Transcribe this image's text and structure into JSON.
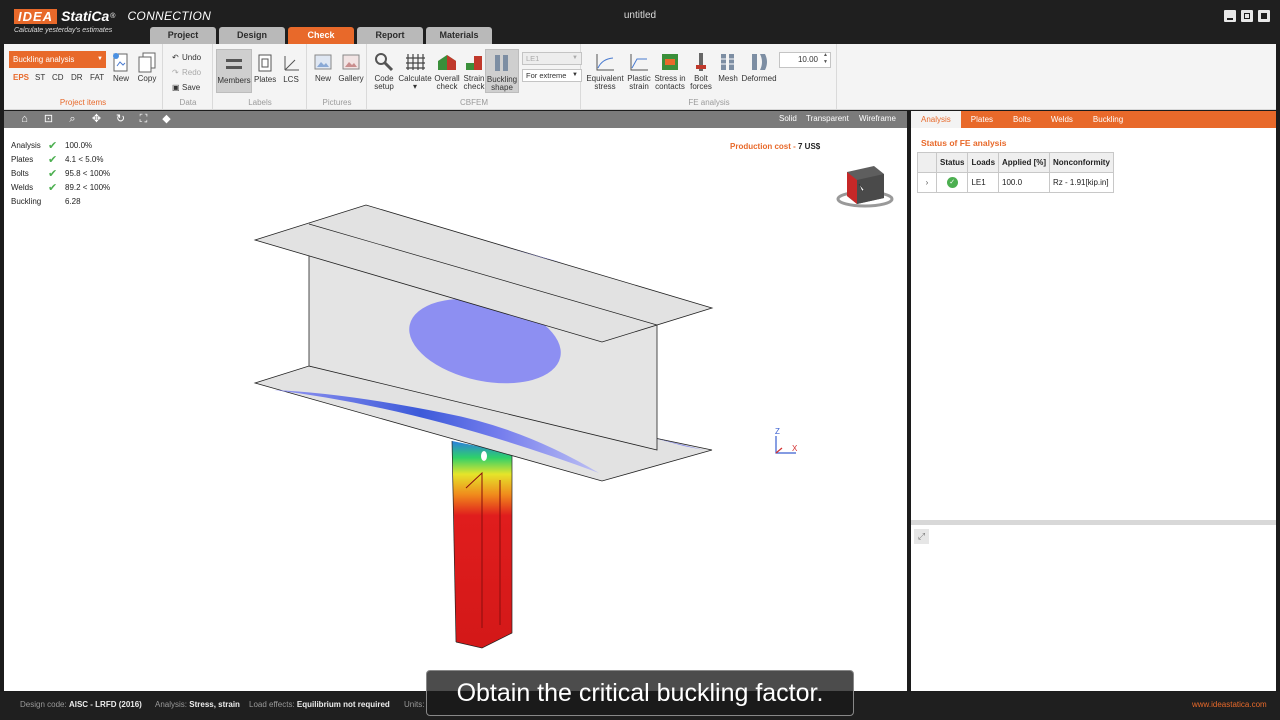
{
  "app": {
    "logo_idea": "IDEA",
    "logo_statica": "StatiCa",
    "logo_reg": "®",
    "product": "CONNECTION",
    "slogan": "Calculate yesterday's estimates",
    "document_title": "untitled"
  },
  "tabs": [
    {
      "label": "Project",
      "active": false
    },
    {
      "label": "Design",
      "active": false
    },
    {
      "label": "Check",
      "active": true
    },
    {
      "label": "Report",
      "active": false
    },
    {
      "label": "Materials",
      "active": false
    }
  ],
  "ribbon": {
    "project_items": {
      "check_type": "Buckling analysis",
      "check_tabs": [
        "EPS",
        "ST",
        "CD",
        "DR",
        "FAT"
      ],
      "active_check_tab": "EPS",
      "new_label": "New",
      "copy_label": "Copy",
      "group_label": "Project items"
    },
    "data": {
      "undo": "Undo",
      "redo": "Redo",
      "save": "Save",
      "group_label": "Data"
    },
    "labels": {
      "members": "Members",
      "plates": "Plates",
      "lcs": "LCS",
      "group_label": "Labels"
    },
    "pictures": {
      "new": "New",
      "gallery": "Gallery",
      "group_label": "Pictures"
    },
    "cbfem": {
      "code_setup_1": "Code",
      "code_setup_2": "setup",
      "calculate": "Calculate",
      "overall_1": "Overall",
      "overall_2": "check",
      "strain_1": "Strain",
      "strain_2": "check",
      "buckling_1": "Buckling",
      "buckling_2": "shape",
      "load_case": "LE1",
      "extreme": "For extreme",
      "group_label": "CBFEM"
    },
    "fe_analysis": {
      "equivalent_1": "Equivalent",
      "equivalent_2": "stress",
      "plastic_1": "Plastic",
      "plastic_2": "strain",
      "contacts_1": "Stress in",
      "contacts_2": "contacts",
      "bolt_1": "Bolt",
      "bolt_2": "forces",
      "mesh": "Mesh",
      "deformed": "Deformed",
      "scale": "10.00",
      "group_label": "FE analysis"
    }
  },
  "viewport": {
    "modes": [
      "Solid",
      "Transparent",
      "Wireframe"
    ],
    "results": [
      {
        "label": "Analysis",
        "ok": true,
        "value": "100.0%"
      },
      {
        "label": "Plates",
        "ok": true,
        "value": "4.1 < 5.0%"
      },
      {
        "label": "Bolts",
        "ok": true,
        "value": "95.8 < 100%"
      },
      {
        "label": "Welds",
        "ok": true,
        "value": "89.2 < 100%"
      },
      {
        "label": "Buckling",
        "ok": false,
        "value": "6.28"
      }
    ],
    "production_cost_label": "Production cost",
    "production_cost_sep": " - ",
    "production_cost_value": "7 US$",
    "axis_z": "Z",
    "axis_x": "X"
  },
  "panel": {
    "tabs": [
      "Analysis",
      "Plates",
      "Bolts",
      "Welds",
      "Buckling"
    ],
    "active_tab": "Analysis",
    "title": "Status of FE analysis",
    "columns": [
      "Status",
      "Loads",
      "Applied [%]",
      "Nonconformity"
    ],
    "rows": [
      {
        "load": "LE1",
        "applied": "100.0",
        "nonconformity": "Rz - 1.91[kip.in]"
      }
    ]
  },
  "statusbar": {
    "design_code_label": "Design code:",
    "design_code": "AISC - LRFD (2016)",
    "analysis_label": "Analysis:",
    "analysis": "Stress, strain",
    "load_effects_label": "Load effects:",
    "load_effects": "Equilibrium not required",
    "units_label": "Units:",
    "website": "www.ideastatica.com"
  },
  "subtitle": "Obtain the critical buckling factor.",
  "colors": {
    "accent": "#e8692a",
    "ok": "#4caf50"
  }
}
